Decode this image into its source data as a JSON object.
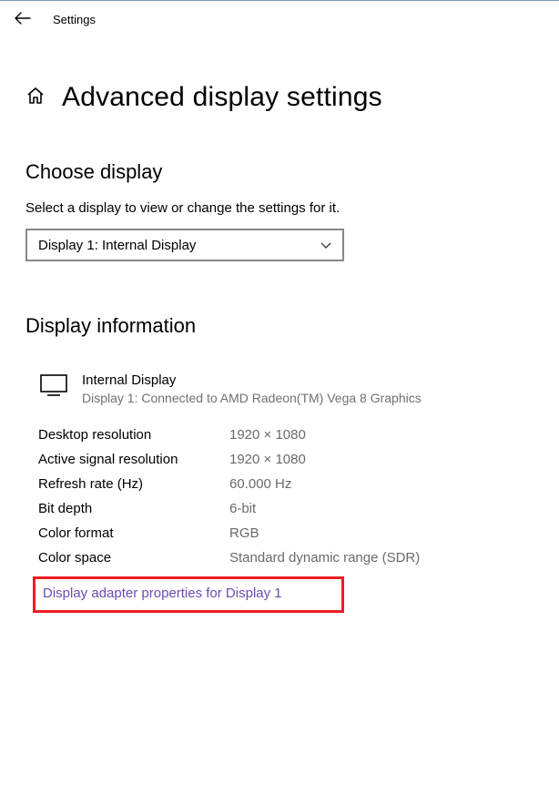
{
  "topbar": {
    "title": "Settings"
  },
  "page": {
    "title": "Advanced display settings"
  },
  "choose": {
    "heading": "Choose display",
    "desc": "Select a display to view or change the settings for it.",
    "selected": "Display 1: Internal Display"
  },
  "info": {
    "heading": "Display information",
    "display_name": "Internal Display",
    "display_sub": "Display 1: Connected to AMD Radeon(TM) Vega 8 Graphics",
    "rows": {
      "desktop_res_label": "Desktop resolution",
      "desktop_res_value": "1920 × 1080",
      "active_res_label": "Active signal resolution",
      "active_res_value": "1920 × 1080",
      "refresh_label": "Refresh rate (Hz)",
      "refresh_value": "60.000 Hz",
      "bitdepth_label": "Bit depth",
      "bitdepth_value": "6-bit",
      "colorfmt_label": "Color format",
      "colorfmt_value": "RGB",
      "colorspace_label": "Color space",
      "colorspace_value": "Standard dynamic range (SDR)"
    },
    "link": "Display adapter properties for Display 1"
  }
}
